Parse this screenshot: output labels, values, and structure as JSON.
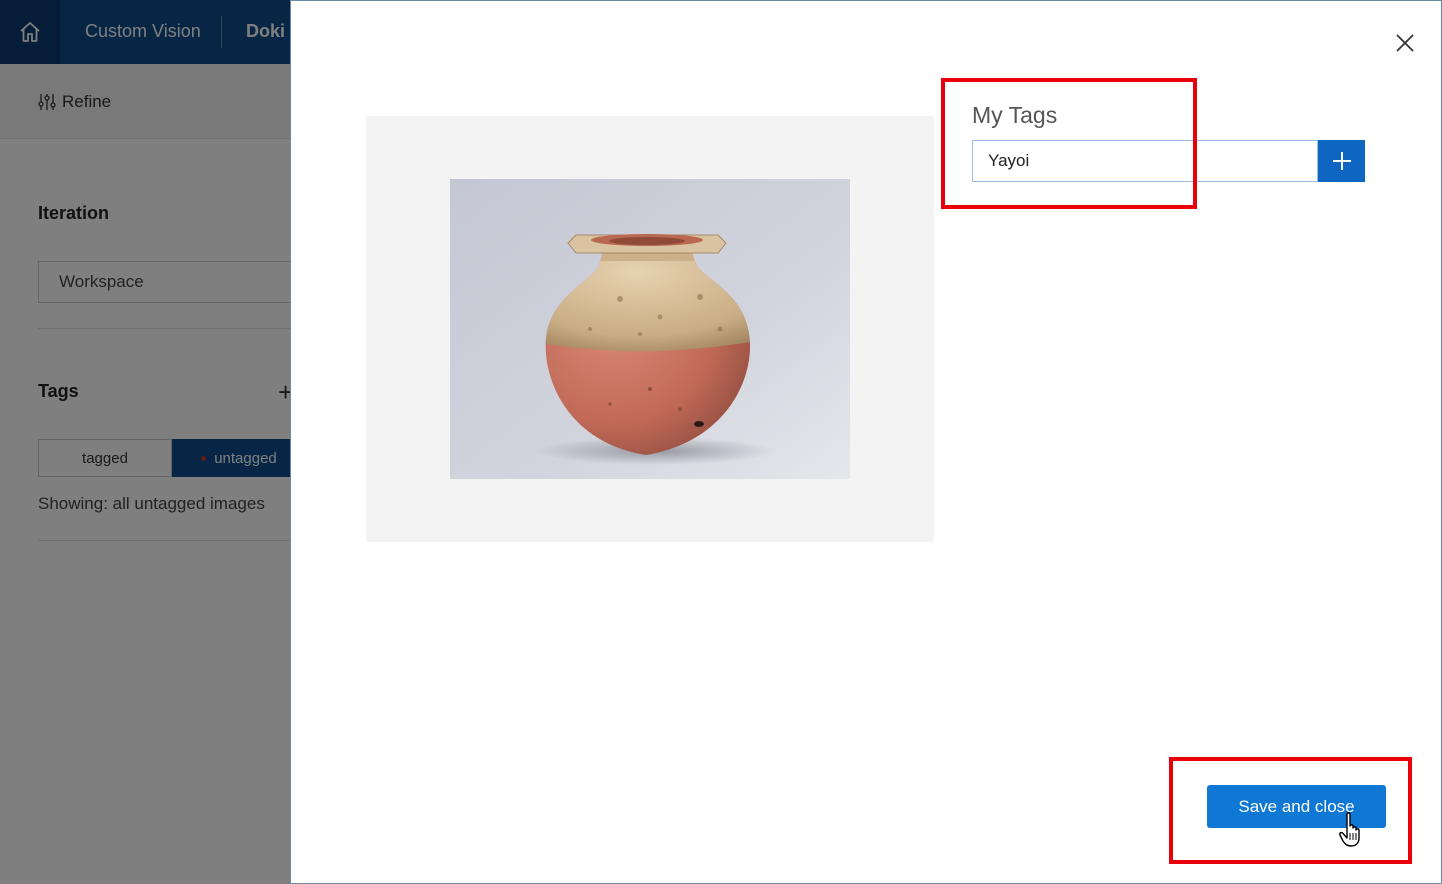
{
  "header": {
    "brand": "Custom Vision",
    "project": "Doki",
    "home_icon": "home-icon"
  },
  "toolbar": {
    "refine_label": "Refine",
    "refine_icon": "sliders-icon"
  },
  "sidebar": {
    "iteration_title": "Iteration",
    "iteration_value": "Workspace",
    "tags_title": "Tags",
    "filters": [
      {
        "label": "tagged",
        "active": false
      },
      {
        "label": "untagged",
        "active": true
      }
    ],
    "showing_text": "Showing: all untagged images"
  },
  "dialog": {
    "my_tags_label": "My Tags",
    "tag_input_value": "Yayoi",
    "add_tag_icon": "plus-icon",
    "close_icon": "close-icon",
    "save_label": "Save and close"
  },
  "colors": {
    "header_bg": "#0e4c8b",
    "primary_button": "#0f78d4",
    "highlight": "#e8000b"
  }
}
